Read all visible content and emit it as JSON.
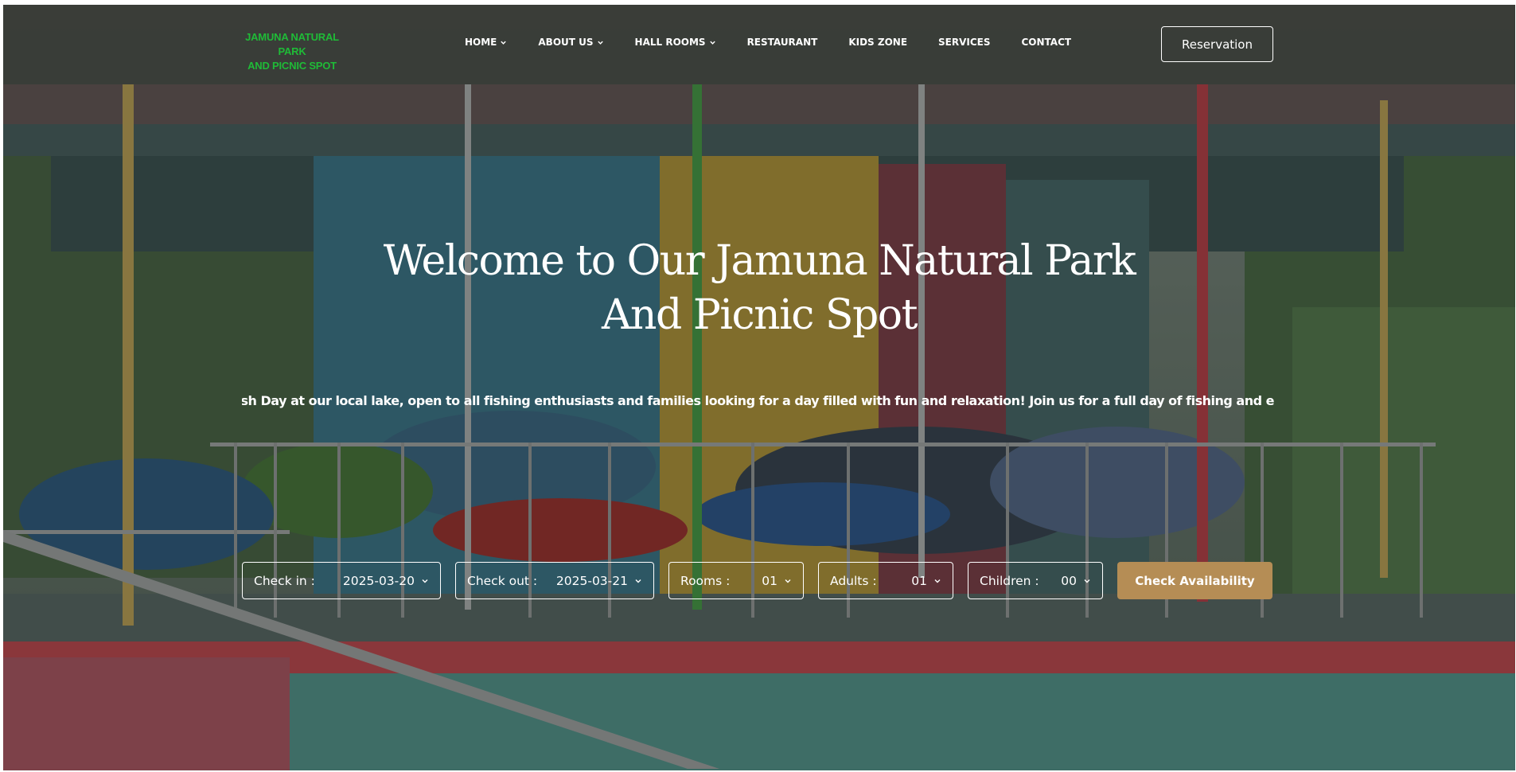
{
  "brand": {
    "logo_line1": "JAMUNA NATURAL PARK",
    "logo_line2": "AND PICNIC SPOT",
    "logo_color": "#1fbb37"
  },
  "nav": {
    "items": [
      {
        "label": "HOME",
        "has_dropdown": true
      },
      {
        "label": "ABOUT US",
        "has_dropdown": true
      },
      {
        "label": "HALL ROOMS",
        "has_dropdown": true
      },
      {
        "label": "RESTAURANT",
        "has_dropdown": false
      },
      {
        "label": "KIDS ZONE",
        "has_dropdown": false
      },
      {
        "label": "SERVICES",
        "has_dropdown": false
      },
      {
        "label": "CONTACT",
        "has_dropdown": false
      }
    ],
    "reservation_label": "Reservation"
  },
  "hero": {
    "title_line1": "Welcome to Our Jamuna Natural Park",
    "title_line2": "And Picnic Spot",
    "ticker": "tching Fish Day at our local lake, open to all fishing enthusiasts and families looking for a day filled with fun and relaxation! Join us for a full day of fishing and e"
  },
  "booking": {
    "checkin_label": "Check in :",
    "checkin_value": "2025-03-20",
    "checkout_label": "Check out :",
    "checkout_value": "2025-03-21",
    "rooms_label": "Rooms :",
    "rooms_value": "01",
    "adults_label": "Adults :",
    "adults_value": "01",
    "children_label": "Children :",
    "children_value": "00",
    "check_label": "Check Availability"
  },
  "colors": {
    "accent": "#b58d55",
    "header_bg": "#323430"
  }
}
